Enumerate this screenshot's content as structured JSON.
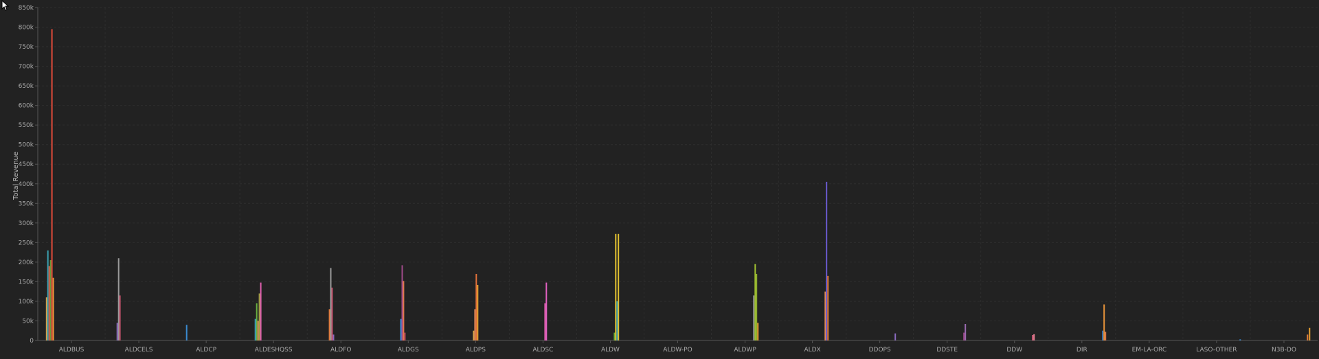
{
  "chart_data": {
    "type": "bar",
    "ylabel": "Total Revenue",
    "xlabel": "",
    "ylim": [
      0,
      850000
    ],
    "y_ticks": [
      "0",
      "50k",
      "100k",
      "150k",
      "200k",
      "250k",
      "300k",
      "350k",
      "400k",
      "450k",
      "500k",
      "550k",
      "600k",
      "650k",
      "700k",
      "750k",
      "800k",
      "850k"
    ],
    "y_tick_values": [
      0,
      50000,
      100000,
      150000,
      200000,
      250000,
      300000,
      350000,
      400000,
      450000,
      500000,
      550000,
      600000,
      650000,
      700000,
      750000,
      800000,
      850000
    ],
    "grid": true,
    "categories": [
      "ALDBUS",
      "ALDCELS",
      "ALDCP",
      "ALDESHQSS",
      "ALDFO",
      "ALDGS",
      "ALDPS",
      "ALDSC",
      "ALDW",
      "ALDW-PO",
      "ALDWP",
      "ALDX",
      "DDOPS",
      "DDSTE",
      "DDW",
      "DIR",
      "EM-LA-ORC",
      "LASO-OTHER",
      "N3B-DO"
    ],
    "bars": [
      {
        "category": "ALDBUS",
        "offset": -0.38,
        "value": 110000,
        "color": "#d9a24a"
      },
      {
        "category": "ALDBUS",
        "offset": -0.36,
        "value": 230000,
        "color": "#3aa0b0"
      },
      {
        "category": "ALDBUS",
        "offset": -0.34,
        "value": 190000,
        "color": "#e05a4a"
      },
      {
        "category": "ALDBUS",
        "offset": -0.32,
        "value": 205000,
        "color": "#6a9a3a"
      },
      {
        "category": "ALDBUS",
        "offset": -0.3,
        "value": 795000,
        "color": "#e04a3a"
      },
      {
        "category": "ALDBUS",
        "offset": -0.28,
        "value": 160000,
        "color": "#e8943a"
      },
      {
        "category": "ALDCELS",
        "offset": -0.33,
        "value": 45000,
        "color": "#8a6ac0"
      },
      {
        "category": "ALDCELS",
        "offset": -0.31,
        "value": 210000,
        "color": "#9a9a9a"
      },
      {
        "category": "ALDCELS",
        "offset": -0.29,
        "value": 115000,
        "color": "#c0506a"
      },
      {
        "category": "ALDCP",
        "offset": -0.3,
        "value": 40000,
        "color": "#3a8ad0"
      },
      {
        "category": "ALDESHQSS",
        "offset": -0.28,
        "value": 55000,
        "color": "#3aa0c0"
      },
      {
        "category": "ALDESHQSS",
        "offset": -0.26,
        "value": 95000,
        "color": "#6ab040"
      },
      {
        "category": "ALDESHQSS",
        "offset": -0.24,
        "value": 50000,
        "color": "#e08a5a"
      },
      {
        "category": "ALDESHQSS",
        "offset": -0.22,
        "value": 120000,
        "color": "#a0a040"
      },
      {
        "category": "ALDESHQSS",
        "offset": -0.2,
        "value": 148000,
        "color": "#e060b0"
      },
      {
        "category": "ALDFO",
        "offset": -0.18,
        "value": 80000,
        "color": "#e07a3a"
      },
      {
        "category": "ALDFO",
        "offset": -0.16,
        "value": 185000,
        "color": "#9a9a9a"
      },
      {
        "category": "ALDFO",
        "offset": -0.14,
        "value": 135000,
        "color": "#c0506a"
      },
      {
        "category": "ALDFO",
        "offset": -0.12,
        "value": 15000,
        "color": "#8a6ac0"
      },
      {
        "category": "ALDGS",
        "offset": -0.12,
        "value": 55000,
        "color": "#3a8ad0"
      },
      {
        "category": "ALDGS",
        "offset": -0.1,
        "value": 192000,
        "color": "#a04a8a"
      },
      {
        "category": "ALDGS",
        "offset": -0.08,
        "value": 152000,
        "color": "#e07a4a"
      },
      {
        "category": "ALDGS",
        "offset": -0.06,
        "value": 20000,
        "color": "#c04a5a"
      },
      {
        "category": "ALDPS",
        "offset": -0.04,
        "value": 25000,
        "color": "#d9a24a"
      },
      {
        "category": "ALDPS",
        "offset": -0.02,
        "value": 80000,
        "color": "#e08a5a"
      },
      {
        "category": "ALDPS",
        "offset": 0.0,
        "value": 170000,
        "color": "#e0703a"
      },
      {
        "category": "ALDPS",
        "offset": 0.02,
        "value": 142000,
        "color": "#e8a030"
      },
      {
        "category": "ALDSC",
        "offset": 0.02,
        "value": 95000,
        "color": "#e060b0"
      },
      {
        "category": "ALDSC",
        "offset": 0.04,
        "value": 148000,
        "color": "#e060c0"
      },
      {
        "category": "ALDW",
        "offset": 0.05,
        "value": 20000,
        "color": "#6ab040"
      },
      {
        "category": "ALDW",
        "offset": 0.07,
        "value": 272000,
        "color": "#e0c030"
      },
      {
        "category": "ALDW",
        "offset": 0.09,
        "value": 100000,
        "color": "#3aa0b0"
      },
      {
        "category": "ALDW",
        "offset": 0.11,
        "value": 272000,
        "color": "#e0c030"
      },
      {
        "category": "ALDWP",
        "offset": 0.12,
        "value": 115000,
        "color": "#9a9a9a"
      },
      {
        "category": "ALDWP",
        "offset": 0.14,
        "value": 195000,
        "color": "#a0c030"
      },
      {
        "category": "ALDWP",
        "offset": 0.16,
        "value": 170000,
        "color": "#90b030"
      },
      {
        "category": "ALDWP",
        "offset": 0.18,
        "value": 45000,
        "color": "#e8a030"
      },
      {
        "category": "ALDX",
        "offset": 0.18,
        "value": 125000,
        "color": "#e08a5a"
      },
      {
        "category": "ALDX",
        "offset": 0.2,
        "value": 405000,
        "color": "#6a5ad0"
      },
      {
        "category": "ALDX",
        "offset": 0.22,
        "value": 165000,
        "color": "#e07a3a"
      },
      {
        "category": "DDOPS",
        "offset": 0.22,
        "value": 18000,
        "color": "#8a6ac0"
      },
      {
        "category": "DDSTE",
        "offset": 0.24,
        "value": 20000,
        "color": "#a04a8a"
      },
      {
        "category": "DDSTE",
        "offset": 0.26,
        "value": 42000,
        "color": "#9a6ab0"
      },
      {
        "category": "DDW",
        "offset": 0.26,
        "value": 14000,
        "color": "#e06080"
      },
      {
        "category": "DDW",
        "offset": 0.28,
        "value": 16000,
        "color": "#e08090"
      },
      {
        "category": "DIR",
        "offset": 0.3,
        "value": 25000,
        "color": "#3a7ac0"
      },
      {
        "category": "DIR",
        "offset": 0.32,
        "value": 92000,
        "color": "#e8943a"
      },
      {
        "category": "DIR",
        "offset": 0.34,
        "value": 22000,
        "color": "#e07a4a"
      },
      {
        "category": "LASO-OTHER",
        "offset": 0.34,
        "value": 3000,
        "color": "#3a8ad0"
      },
      {
        "category": "N3B-DO",
        "offset": 0.34,
        "value": 15000,
        "color": "#e07a3a"
      },
      {
        "category": "N3B-DO",
        "offset": 0.37,
        "value": 32000,
        "color": "#e8a030"
      }
    ]
  }
}
